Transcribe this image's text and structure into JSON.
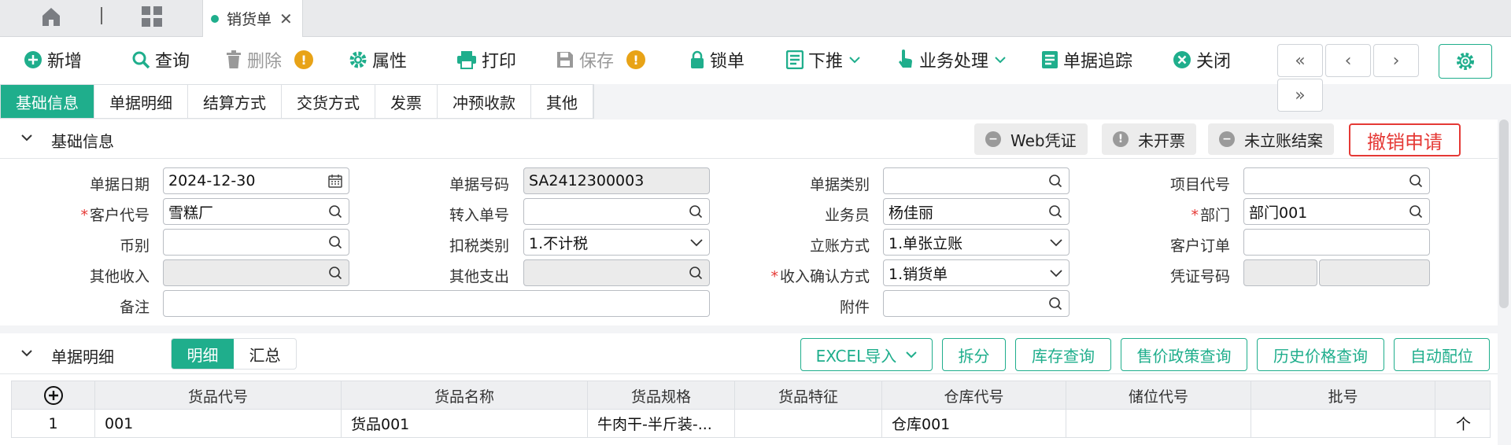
{
  "topbar": {
    "home_icon": "home-icon",
    "apps_icon": "grid-icon",
    "tab_title": "销货单",
    "tab_close": "✕"
  },
  "toolbar": {
    "add": "新增",
    "query": "查询",
    "delete": "删除",
    "props": "属性",
    "print": "打印",
    "save": "保存",
    "lock": "锁单",
    "push": "下推",
    "business": "业务处理",
    "trace": "单据追踪",
    "close": "关闭",
    "first": "«",
    "prev": "‹",
    "next": "›",
    "last": "»"
  },
  "tabs": [
    "基础信息",
    "单据明细",
    "结算方式",
    "交货方式",
    "发票",
    "冲预收款",
    "其他"
  ],
  "basic": {
    "title": "基础信息",
    "status": {
      "voucher": "Web凭证",
      "invoice": "未开票",
      "account": "未立账结案"
    },
    "revoke": "撤销申请",
    "labels": {
      "date": "单据日期",
      "no": "单据号码",
      "type": "单据类别",
      "project": "项目代号",
      "customer": "客户代号",
      "transfer": "转入单号",
      "salesman": "业务员",
      "dept": "部门",
      "currency": "币别",
      "tax": "扣税类别",
      "account_mode": "立账方式",
      "cust_order": "客户订单",
      "other_income": "其他收入",
      "other_expense": "其他支出",
      "income_confirm": "收入确认方式",
      "voucher_no": "凭证号码",
      "remark": "备注",
      "attach": "附件"
    },
    "values": {
      "date": "2024-12-30",
      "no": "SA2412300003",
      "type": "",
      "project": "",
      "customer": "雪糕厂",
      "transfer": "",
      "salesman": "杨佳丽",
      "dept": "部门001",
      "currency": "",
      "tax": "1.不计税",
      "account_mode": "1.单张立账",
      "cust_order": "",
      "other_income": "",
      "other_expense": "",
      "income_confirm": "1.销货单",
      "remark": "",
      "attach": ""
    }
  },
  "detail": {
    "title": "单据明细",
    "toggle": [
      "明细",
      "汇总"
    ],
    "buttons": {
      "excel": "EXCEL导入",
      "split": "拆分",
      "stock": "库存查询",
      "price_policy": "售价政策查询",
      "history": "历史价格查询",
      "auto": "自动配位"
    },
    "columns": [
      "货品代号",
      "货品名称",
      "货品规格",
      "货品特征",
      "仓库代号",
      "储位代号",
      "批号"
    ],
    "rows": [
      {
        "idx": "1",
        "code": "001",
        "name": "货品001",
        "spec": "牛肉干-半斤装-...",
        "feature": "",
        "wh": "仓库001",
        "loc": "",
        "lot": "",
        "unit": "个"
      }
    ]
  },
  "colors": {
    "accent": "#1fae8c",
    "danger": "#e53935",
    "warning": "#e8a317"
  }
}
